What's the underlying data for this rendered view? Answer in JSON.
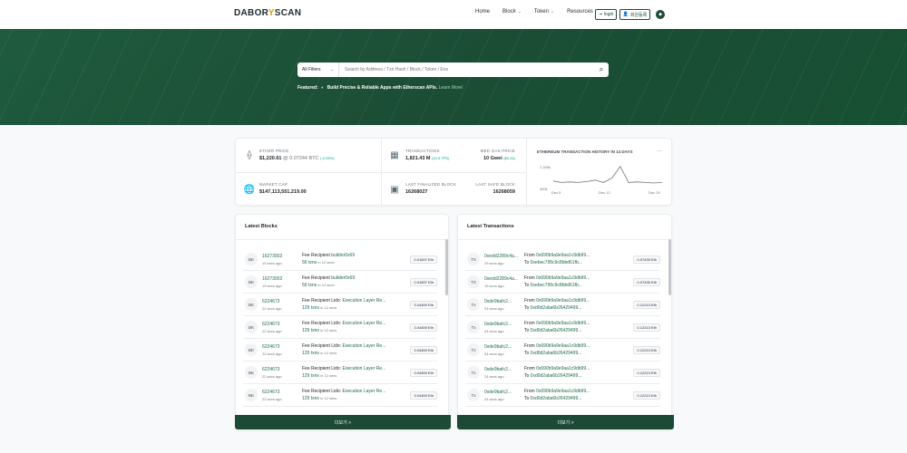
{
  "header": {
    "logo_left": "DABOR",
    "logo_mid": "Y",
    "logo_right": "SCAN",
    "nav": [
      {
        "label": "Home"
      },
      {
        "label": "Block"
      },
      {
        "label": "Token"
      },
      {
        "label": "Resources"
      }
    ],
    "login_label": "login",
    "signup_label": "회원등록"
  },
  "search": {
    "filter_label": "All Filters",
    "placeholder": "Search by Address / Txn Hash / Block / Token / Ens"
  },
  "featured": {
    "prefix": "Featured:",
    "text": "Build Precise & Reliable Apps with Etherscan APIs.",
    "link": "Learn More!"
  },
  "stats": {
    "ether_price_label": "ETHER PRICE",
    "ether_price_value": "$1,220.61",
    "ether_price_btc": "@ 0.07244 BTC",
    "ether_price_change": "(-0.03%)",
    "transactions_label": "TRANSACTIONS",
    "transactions_value": "1,821.43 M",
    "transactions_tps": "(10.5 TPS)",
    "gas_label": "MED GAS PRICE",
    "gas_value": "10 Gwei",
    "gas_usd": "($0.26)",
    "market_cap_label": "MARKET CAP",
    "market_cap_value": "$147,113,551,219.00",
    "finalized_label": "LAST FINALIZED BLOCK",
    "finalized_value": "16268027",
    "safe_label": "LAST SAFE BLOCK",
    "safe_value": "16268059",
    "history_title": "ETHEREUM TRANSACTION HISTORY IN 14 DAYS",
    "history_y_top": "1 200k",
    "history_y_bottom": "400k",
    "history_x": [
      "Dec 5",
      "Dec 12",
      "Dec 19"
    ],
    "history_series": [
      0.35,
      0.3,
      0.32,
      0.3,
      0.33,
      0.38,
      0.3,
      0.45,
      0.85,
      0.3,
      0.32,
      0.3,
      0.28,
      0.3
    ]
  },
  "latest_blocks": {
    "title": "Latest Blocks",
    "rows": [
      {
        "badge": "BK",
        "block": "16273002",
        "age": "19 secs ago",
        "fee": "Fee Recipient",
        "recipient": "builder0x69",
        "txns": "56 txns",
        "in": "in 12 secs",
        "reward": "0.01697 Eth"
      },
      {
        "badge": "BK",
        "block": "16273002",
        "age": "19 secs ago",
        "fee": "Fee Recipient",
        "recipient": "builder0x69",
        "txns": "56 txns",
        "in": "in 12 secs",
        "reward": "0.01697 Eth"
      },
      {
        "badge": "BK",
        "block": "6224673",
        "age": "22 secs ago",
        "fee": "Fee Recipient Lido:",
        "recipient": "Execution Layer Re...",
        "txns": "129 txns",
        "in": "in 12 secs",
        "reward": "3.04459 Eth"
      },
      {
        "badge": "BK",
        "block": "6224673",
        "age": "22 secs ago",
        "fee": "Fee Recipient Lido:",
        "recipient": "Execution Layer Re...",
        "txns": "129 txns",
        "in": "in 12 secs",
        "reward": "3.04459 Eth"
      },
      {
        "badge": "BK",
        "block": "6224673",
        "age": "22 secs ago",
        "fee": "Fee Recipient Lido:",
        "recipient": "Execution Layer Re...",
        "txns": "129 txns",
        "in": "in 12 secs",
        "reward": "3.04459 Eth"
      },
      {
        "badge": "BK",
        "block": "6224673",
        "age": "22 secs ago",
        "fee": "Fee Recipient Lido:",
        "recipient": "Execution Layer Re...",
        "txns": "129 txns",
        "in": "in 12 secs",
        "reward": "3.04459 Eth"
      },
      {
        "badge": "BK",
        "block": "6224673",
        "age": "22 secs ago",
        "fee": "Fee Recipient Lido:",
        "recipient": "Execution Layer Re...",
        "txns": "129 txns",
        "in": "in 12 secs",
        "reward": "3.04459 Eth"
      }
    ],
    "more_label": "더보기 >"
  },
  "latest_transactions": {
    "title": "Latest Transactions",
    "rows": [
      {
        "badge": "TX",
        "hash": "0xedd2289c4a...",
        "age": "19 secs ago",
        "from": "0x690b9a9e9aa1c9db99...",
        "to": "0xebec795c9c8bbd61fb...",
        "amount": "0.07435 Eth"
      },
      {
        "badge": "TX",
        "hash": "0xedd2289c4a...",
        "age": "19 secs ago",
        "from": "0x690b9a9e9aa1c9db99...",
        "to": "0xebec795c9c8bbd61fb...",
        "amount": "0.07435 Eth"
      },
      {
        "badge": "Tx",
        "hash": "0xde9bafc2...",
        "age": "24 secs ago",
        "from": "0x690b9a9e9aa1c9db99...",
        "to": "0xd0d2aba6b26429499...",
        "amount": "0.12213 Eth"
      },
      {
        "badge": "Tx",
        "hash": "0xde9bafc2...",
        "age": "24 secs ago",
        "from": "0x690b9a9e9aa1c9db99...",
        "to": "0xd0d2aba6b26429499...",
        "amount": "0.12213 Eth"
      },
      {
        "badge": "Tx",
        "hash": "0xde9bafc2...",
        "age": "24 secs ago",
        "from": "0x690b9a9e9aa1c9db99...",
        "to": "0xd0d2aba6b26429499...",
        "amount": "0.12213 Eth"
      },
      {
        "badge": "Tx",
        "hash": "0xde9bafc2...",
        "age": "24 secs ago",
        "from": "0x690b9a9e9aa1c9db99...",
        "to": "0xd0d2aba6b26429499...",
        "amount": "0.12213 Eth"
      },
      {
        "badge": "Tx",
        "hash": "0xde9bafc2...",
        "age": "24 secs ago",
        "from": "0x690b9a9e9aa1c9db99...",
        "to": "0xd0d2aba6b26429499...",
        "amount": "0.12213 Eth"
      }
    ],
    "more_label": "더보기 >"
  }
}
